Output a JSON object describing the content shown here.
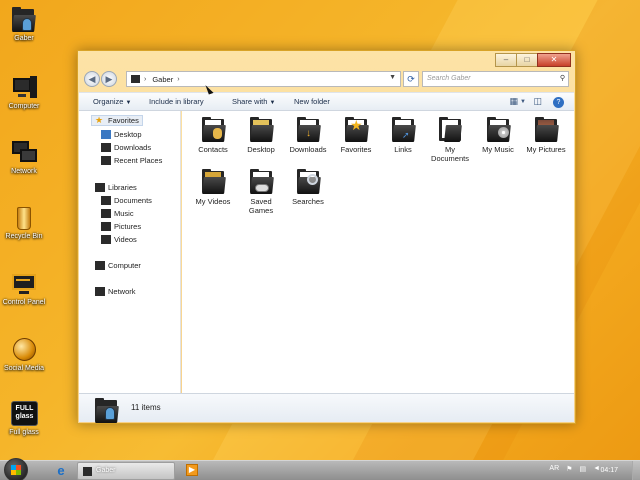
{
  "desktop": {
    "icons": [
      {
        "label": "Gaber",
        "icon": "user-folder-icon"
      },
      {
        "label": "Computer",
        "icon": "computer-icon"
      },
      {
        "label": "Network",
        "icon": "network-icon"
      },
      {
        "label": "Recycle Bin",
        "icon": "recycle-bin-icon"
      },
      {
        "label": "Control Panel",
        "icon": "control-panel-icon"
      },
      {
        "label": "Social Media",
        "icon": "globe-icon"
      },
      {
        "label": "Full glass",
        "icon": "full-glass-icon",
        "badge_line1": "FULL",
        "badge_line2": "glass"
      }
    ]
  },
  "window": {
    "address": {
      "root_crumb": "Gaber",
      "separator": "›"
    },
    "search_placeholder": "Search Gaber",
    "toolbar": {
      "organize": "Organize",
      "include_in_library": "Include in library",
      "share_with": "Share with",
      "new_folder": "New folder"
    },
    "nav": {
      "favorites": "Favorites",
      "favorites_items": [
        "Desktop",
        "Downloads",
        "Recent Places"
      ],
      "libraries": "Libraries",
      "libraries_items": [
        "Documents",
        "Music",
        "Pictures",
        "Videos"
      ],
      "computer": "Computer",
      "network": "Network"
    },
    "items": [
      {
        "name": "Contacts",
        "icon": "contacts-folder-icon"
      },
      {
        "name": "Desktop",
        "icon": "desktop-folder-icon"
      },
      {
        "name": "Downloads",
        "icon": "downloads-folder-icon"
      },
      {
        "name": "Favorites",
        "icon": "favorites-folder-icon"
      },
      {
        "name": "Links",
        "icon": "links-folder-icon"
      },
      {
        "name": "My Documents",
        "icon": "documents-folder-icon"
      },
      {
        "name": "My Music",
        "icon": "music-folder-icon"
      },
      {
        "name": "My Pictures",
        "icon": "pictures-folder-icon"
      },
      {
        "name": "My Videos",
        "icon": "videos-folder-icon"
      },
      {
        "name": "Saved Games",
        "icon": "games-folder-icon"
      },
      {
        "name": "Searches",
        "icon": "searches-folder-icon"
      }
    ],
    "details": {
      "count": "11 items"
    }
  },
  "taskbar": {
    "task_label": "Gaber",
    "language": "AR",
    "clock": "04:17"
  },
  "colors": {
    "desktop_bg": "#f3a81e",
    "window_frame": "#f7d18a",
    "folder_dark": "#262626",
    "accent_blue": "#1b6fc7"
  }
}
